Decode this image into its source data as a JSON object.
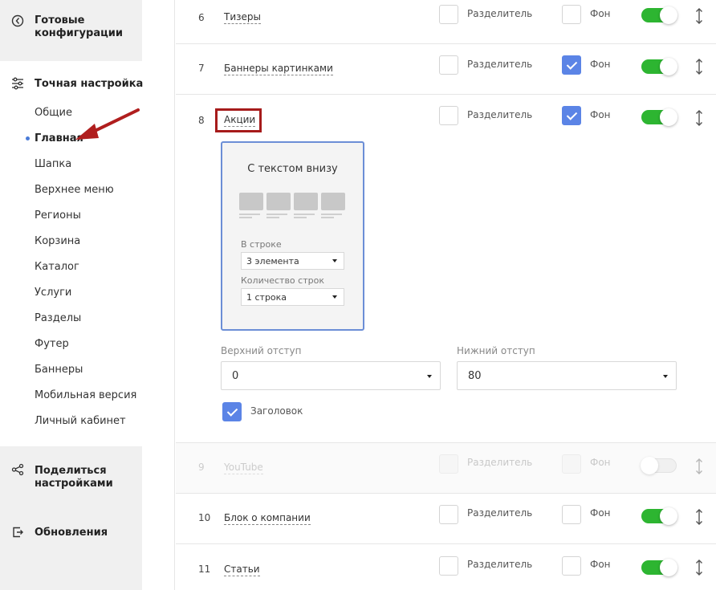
{
  "sidebar": {
    "section_ready": "Готовые конфигурации",
    "section_fine": "Точная настройка",
    "items": [
      "Общие",
      "Главная",
      "Шапка",
      "Верхнее меню",
      "Регионы",
      "Корзина",
      "Каталог",
      "Услуги",
      "Разделы",
      "Футер",
      "Баннеры",
      "Мобильная версия",
      "Личный кабинет"
    ],
    "section_share": "Поделиться настройками",
    "section_updates": "Обновления"
  },
  "rows": [
    {
      "num": "6",
      "name": "Тизеры",
      "separator": "Разделитель",
      "background": "Фон",
      "separator_checked": false,
      "background_checked": false,
      "enabled": true
    },
    {
      "num": "7",
      "name": "Баннеры картинками",
      "separator": "Разделитель",
      "background": "Фон",
      "separator_checked": false,
      "background_checked": true,
      "enabled": true
    },
    {
      "num": "8",
      "name": "Акции",
      "separator": "Разделитель",
      "background": "Фон",
      "separator_checked": false,
      "background_checked": true,
      "enabled": true
    },
    {
      "num": "9",
      "name": "YouTube",
      "separator": "Разделитель",
      "background": "Фон",
      "separator_checked": false,
      "background_checked": false,
      "enabled": false
    },
    {
      "num": "10",
      "name": "Блок о компании",
      "separator": "Разделитель",
      "background": "Фон",
      "separator_checked": false,
      "background_checked": false,
      "enabled": true
    },
    {
      "num": "11",
      "name": "Статьи",
      "separator": "Разделитель",
      "background": "Фон",
      "separator_checked": false,
      "background_checked": false,
      "enabled": true
    }
  ],
  "card": {
    "title": "С текстом внизу",
    "per_row_label": "В строке",
    "per_row_value": "3 элемента",
    "rows_label": "Количество строк",
    "rows_value": "1 строка"
  },
  "padding": {
    "top_label": "Верхний отступ",
    "top_value": "0",
    "bottom_label": "Нижний отступ",
    "bottom_value": "80"
  },
  "heading": {
    "label": "Заголовок",
    "checked": true
  },
  "colors": {
    "accent": "#5b84e6",
    "toggle_on": "#2db531",
    "highlight": "#a61b1b",
    "arrow": "#b01e1e"
  }
}
